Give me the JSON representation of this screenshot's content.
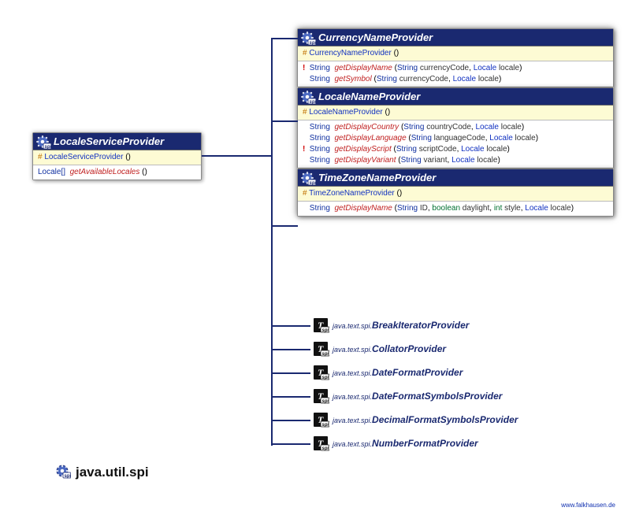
{
  "package_label": "java.util.spi",
  "credit": "www.falkhausen.de",
  "parent": {
    "title": "LocaleServiceProvider",
    "constructor": {
      "vis": "#",
      "name": "LocaleServiceProvider",
      "params": "()"
    },
    "methods": [
      {
        "ret": "Locale[]",
        "name": "getAvailableLocales",
        "params": "()"
      }
    ]
  },
  "children": [
    {
      "title": "CurrencyNameProvider",
      "constructor": {
        "vis": "#",
        "name": "CurrencyNameProvider",
        "params": "()"
      },
      "methods": [
        {
          "flag": "!",
          "ret": "String",
          "name": "getDisplayName",
          "params_raw": "(String currencyCode, Locale locale)"
        },
        {
          "flag": "",
          "ret": "String",
          "name": "getSymbol",
          "params_raw": "(String currencyCode, Locale locale)"
        }
      ]
    },
    {
      "title": "LocaleNameProvider",
      "constructor": {
        "vis": "#",
        "name": "LocaleNameProvider",
        "params": "()"
      },
      "methods": [
        {
          "flag": "",
          "ret": "String",
          "name": "getDisplayCountry",
          "params_raw": "(String countryCode, Locale locale)"
        },
        {
          "flag": "",
          "ret": "String",
          "name": "getDisplayLanguage",
          "params_raw": "(String languageCode, Locale locale)"
        },
        {
          "flag": "!",
          "ret": "String",
          "name": "getDisplayScript",
          "params_raw": "(String scriptCode, Locale locale)"
        },
        {
          "flag": "",
          "ret": "String",
          "name": "getDisplayVariant",
          "params_raw": "(String variant, Locale locale)"
        }
      ]
    },
    {
      "title": "TimeZoneNameProvider",
      "constructor": {
        "vis": "#",
        "name": "TimeZoneNameProvider",
        "params": "()"
      },
      "methods": [
        {
          "flag": "",
          "ret": "String",
          "name": "getDisplayName",
          "params_raw": "(String ID, boolean daylight, int style, Locale locale)"
        }
      ]
    }
  ],
  "external_refs": [
    {
      "pkg": "java.text.spi.",
      "name": "BreakIteratorProvider"
    },
    {
      "pkg": "java.text.spi.",
      "name": "CollatorProvider"
    },
    {
      "pkg": "java.text.spi.",
      "name": "DateFormatProvider"
    },
    {
      "pkg": "java.text.spi.",
      "name": "DateFormatSymbolsProvider"
    },
    {
      "pkg": "java.text.spi.",
      "name": "DecimalFormatSymbolsProvider"
    },
    {
      "pkg": "java.text.spi.",
      "name": "NumberFormatProvider"
    }
  ],
  "chart_data": {
    "type": "table",
    "description": "UML class hierarchy diagram",
    "root": "LocaleServiceProvider",
    "subclasses": [
      "CurrencyNameProvider",
      "LocaleNameProvider",
      "TimeZoneNameProvider",
      "java.text.spi.BreakIteratorProvider",
      "java.text.spi.CollatorProvider",
      "java.text.spi.DateFormatProvider",
      "java.text.spi.DateFormatSymbolsProvider",
      "java.text.spi.DecimalFormatSymbolsProvider",
      "java.text.spi.NumberFormatProvider"
    ]
  }
}
